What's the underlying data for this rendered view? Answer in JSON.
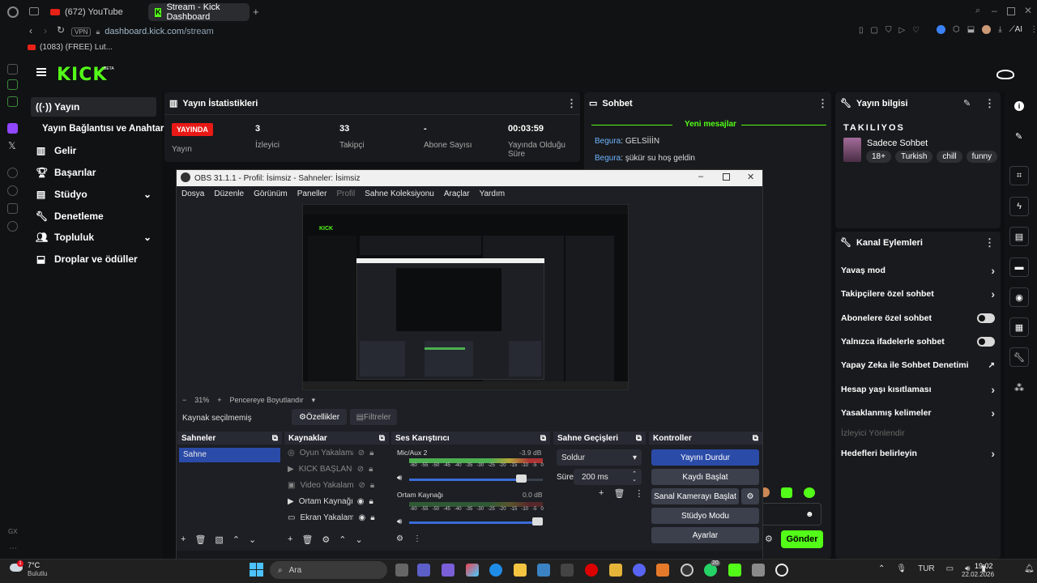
{
  "browser": {
    "tabs": [
      {
        "label": "(672) YouTube"
      },
      {
        "label": "Stream - Kick Dashboard",
        "active": true
      }
    ],
    "url_domain": "dashboard.kick.com",
    "url_path": "/stream",
    "vpn_label": "VPN",
    "ai_label": "AI",
    "bookmark": "(1083) (FREE) Lut...",
    "left_rail_label": "GX"
  },
  "kick": {
    "logo_text": "KICK",
    "logo_badge": "BETA",
    "accent": "#53fc18",
    "nav": [
      {
        "label": "Yayın",
        "icon": "broadcast-icon",
        "active": true
      },
      {
        "label": "Yayın Bağlantısı ve Anahtarı",
        "icon": ""
      },
      {
        "label": "Gelir",
        "icon": "chart-icon"
      },
      {
        "label": "Başarılar",
        "icon": "trophy-icon"
      },
      {
        "label": "Stüdyo",
        "icon": "studio-icon",
        "chevron": true
      },
      {
        "label": "Denetleme",
        "icon": "wrench-icon"
      },
      {
        "label": "Topluluk",
        "icon": "people-icon",
        "chevron": true
      },
      {
        "label": "Droplar ve ödüller",
        "icon": "drops-icon"
      }
    ],
    "stats": {
      "title": "Yayın İstatistikleri",
      "live_badge": "YAYINDA",
      "items": [
        {
          "value": "",
          "label": "Yayın"
        },
        {
          "value": "3",
          "label": "İzleyici"
        },
        {
          "value": "33",
          "label": "Takipçi"
        },
        {
          "value": "-",
          "label": "Abone Sayısı"
        },
        {
          "value": "00:03:59",
          "label": "Yayında Olduğu Süre"
        }
      ]
    },
    "chat": {
      "title": "Sohbet",
      "new_messages": "Yeni mesajlar",
      "messages": [
        {
          "user": "Begura",
          "text": "GELSİİİN"
        },
        {
          "user": "Begura",
          "text": "şükür su hoş geldin"
        }
      ],
      "send_label": "Gönder"
    },
    "stream_info": {
      "title": "Yayın bilgisi",
      "stream_title": "TAKILIYOS",
      "category": "Sadece Sohbet",
      "tags": [
        "18+",
        "Turkish",
        "chill",
        "funny"
      ]
    },
    "channel_actions": {
      "title": "Kanal Eylemleri",
      "items": [
        {
          "label": "Yavaş mod",
          "control": "chevron"
        },
        {
          "label": "Takipçilere özel sohbet",
          "control": "chevron"
        },
        {
          "label": "Abonelere özel sohbet",
          "control": "toggle"
        },
        {
          "label": "Yalnızca ifadelerle sohbet",
          "control": "toggle"
        },
        {
          "label": "Yapay Zeka ile Sohbet Denetimi",
          "control": "external"
        },
        {
          "label": "Hesap yaşı kısıtlaması",
          "control": "chevron"
        },
        {
          "label": "Yasaklanmış kelimeler",
          "control": "chevron"
        },
        {
          "label": "İzleyici Yönlendir",
          "control": "none",
          "disabled": true
        },
        {
          "label": "Hedefleri belirleyin",
          "control": "chevron"
        }
      ]
    }
  },
  "obs": {
    "title": "OBS 31.1.1 - Profil: İsimsiz - Sahneler: İsimsiz",
    "menu": [
      "Dosya",
      "Düzenle",
      "Görünüm",
      "Paneller",
      "Profil",
      "Sahne Koleksiyonu",
      "Araçlar",
      "Yardım"
    ],
    "zoom": "31%",
    "zoom_fit": "Pencereye Boyutlandır",
    "no_source": "Kaynak seçilmemiş",
    "properties_btn": "Özellikler",
    "filters_btn": "Filtreler",
    "scenes": {
      "title": "Sahneler",
      "items": [
        "Sahne"
      ]
    },
    "sources": {
      "title": "Kaynaklar",
      "items": [
        "Oyun Yakalama",
        "KICK BAŞLANGIÇ",
        "Video Yakalama A",
        "Ortam Kaynağı",
        "Ekran Yakalama"
      ]
    },
    "mixer": {
      "title": "Ses Karıştırıcı",
      "channels": [
        {
          "name": "Mic/Aux 2",
          "db": "-3.9 dB",
          "level": 0.88
        },
        {
          "name": "Ortam Kaynağı",
          "db": "0.0 dB",
          "level": 1.0
        }
      ],
      "scale": [
        "-60",
        "-55",
        "-50",
        "-45",
        "-40",
        "-35",
        "-30",
        "-25",
        "-20",
        "-15",
        "-10",
        "-5",
        "0"
      ]
    },
    "transitions": {
      "title": "Sahne Geçişleri",
      "type": "Soldur",
      "duration_label": "Süre",
      "duration": "200 ms"
    },
    "controls": {
      "title": "Kontroller",
      "buttons": [
        "Yayını Durdur",
        "Kaydı Başlat",
        "Sanal Kamerayı Başlat",
        "Stüdyo Modu",
        "Ayarlar"
      ]
    }
  },
  "taskbar": {
    "weather_temp": "7°C",
    "weather_desc": "Bulutlu",
    "search": "Ara",
    "lang": "TUR",
    "time": "19:02",
    "date": "22.02.2026",
    "badge_count": "20"
  }
}
